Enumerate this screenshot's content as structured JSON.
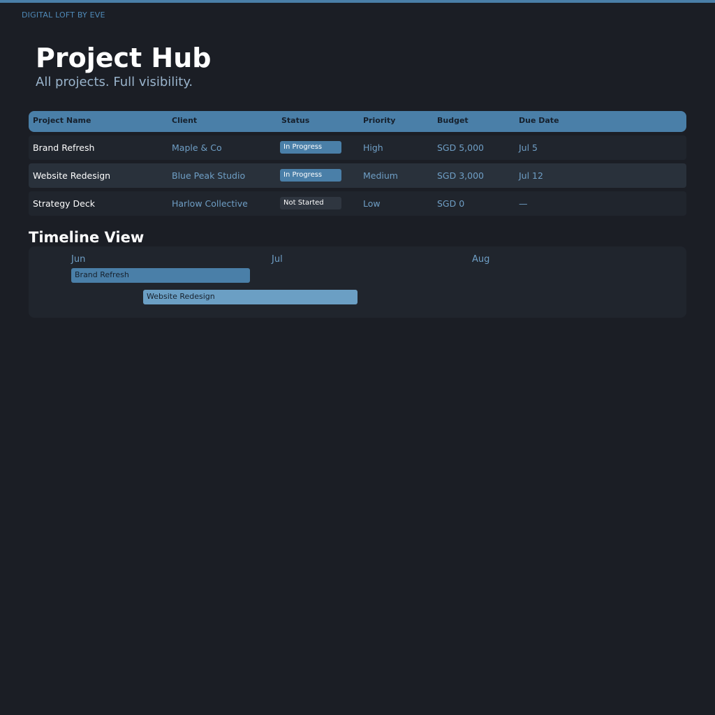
{
  "brand": "DIGITAL LOFT BY EVE",
  "header": {
    "title": "Project Hub",
    "subtitle": "All projects. Full visibility."
  },
  "table": {
    "columns": [
      "Project Name",
      "Client",
      "Status",
      "Priority",
      "Budget",
      "Due Date"
    ],
    "rows": [
      {
        "name": "Brand Refresh",
        "client": "Maple & Co",
        "status": "In Progress",
        "priority": "High",
        "budget": "SGD 5,000",
        "due": "Jul 5"
      },
      {
        "name": "Website Redesign",
        "client": "Blue Peak Studio",
        "status": "In Progress",
        "priority": "Medium",
        "budget": "SGD 3,000",
        "due": "Jul 12"
      },
      {
        "name": "Strategy Deck",
        "client": "Harlow Collective",
        "status": "Not Started",
        "priority": "Low",
        "budget": "SGD 0",
        "due": "—"
      }
    ]
  },
  "timeline": {
    "title": "Timeline View",
    "months": [
      "Jun",
      "Jul",
      "Aug"
    ],
    "bars": [
      {
        "label": "Brand Refresh"
      },
      {
        "label": "Website Redesign"
      }
    ]
  },
  "colors": {
    "accent": "#4a7fa8",
    "background": "#1b1e25",
    "row_alt": "#29313b",
    "muted_text": "#6f9fc6"
  }
}
